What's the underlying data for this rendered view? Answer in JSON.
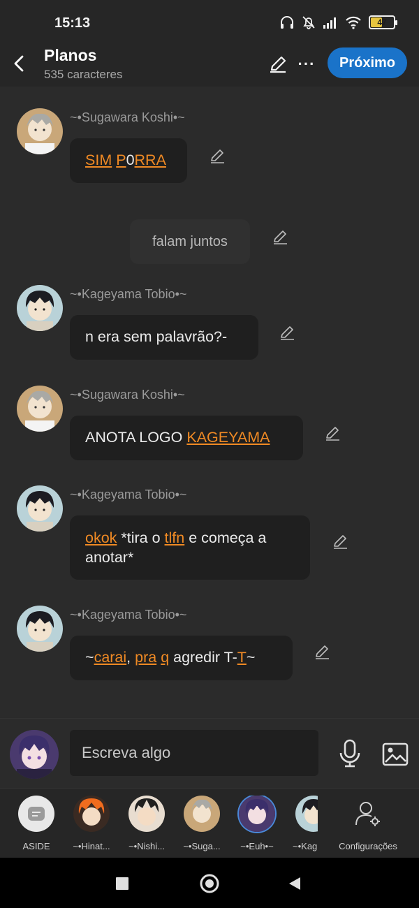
{
  "status_bar": {
    "time": "15:13",
    "battery": "47"
  },
  "header": {
    "title": "Planos",
    "subtitle": "535 caracteres",
    "next_label": "Próximo",
    "more_label": "···"
  },
  "messages": [
    {
      "sender": "~•Sugawara Koshi•~",
      "segments": [
        {
          "text": "SIM",
          "highlight": true
        },
        {
          "text": " ",
          "highlight": false
        },
        {
          "text": "P",
          "highlight": true
        },
        {
          "text": "0",
          "highlight": false
        },
        {
          "text": "RRA",
          "highlight": true
        }
      ]
    },
    {
      "narration": "falam juntos"
    },
    {
      "sender": "~•Kageyama Tobio•~",
      "segments": [
        {
          "text": "n era sem palavrão?-",
          "highlight": false
        }
      ]
    },
    {
      "sender": "~•Sugawara Koshi•~",
      "segments": [
        {
          "text": "ANOTA LOGO ",
          "highlight": false
        },
        {
          "text": "KAGEYAMA",
          "highlight": true
        }
      ]
    },
    {
      "sender": "~•Kageyama Tobio•~",
      "segments": [
        {
          "text": "okok",
          "highlight": true
        },
        {
          "text": " *tira o ",
          "highlight": false
        },
        {
          "text": "tlfn",
          "highlight": true
        },
        {
          "text": " e começa a anotar*",
          "highlight": false
        }
      ]
    },
    {
      "sender": "~•Kageyama Tobio•~",
      "segments": [
        {
          "text": "~",
          "highlight": false
        },
        {
          "text": "carai",
          "highlight": true
        },
        {
          "text": ", ",
          "highlight": false
        },
        {
          "text": "pra",
          "highlight": true
        },
        {
          "text": " ",
          "highlight": false
        },
        {
          "text": "q",
          "highlight": true
        },
        {
          "text": " agredir T-",
          "highlight": false
        },
        {
          "text": "T",
          "highlight": true
        },
        {
          "text": "~",
          "highlight": false
        }
      ]
    }
  ],
  "composer": {
    "placeholder": "Escreva algo"
  },
  "characters": [
    {
      "label": "ASIDE"
    },
    {
      "label": "~•Hinat..."
    },
    {
      "label": "~•Nishi..."
    },
    {
      "label": "~•Suga..."
    },
    {
      "label": "~•Euh•~"
    },
    {
      "label": "~•Kag"
    },
    {
      "label": "Configurações"
    }
  ],
  "colors": {
    "background": "#2b2b2b",
    "bubble": "#1f1f1f",
    "highlight": "#f08a24",
    "accent": "#1a73c9"
  }
}
